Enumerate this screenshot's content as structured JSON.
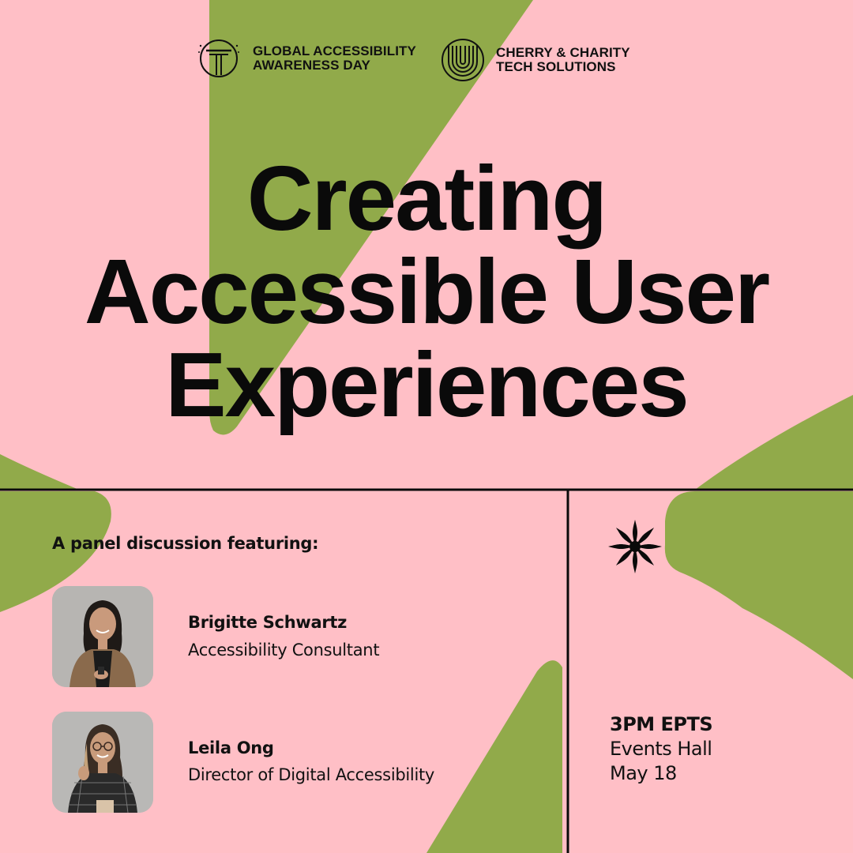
{
  "logos": [
    {
      "icon": "column-pillar-icon",
      "line1": "GLOBAL ACCESSIBILITY",
      "line2": "AWARENESS DAY"
    },
    {
      "icon": "concentric-u-icon",
      "line1": "CHERRY & CHARITY",
      "line2": "TECH SOLUTIONS"
    }
  ],
  "title": {
    "line1": "Creating",
    "line2": "Accessible User",
    "line3": "Experiences"
  },
  "intro": "A panel discussion featuring:",
  "speakers": [
    {
      "name": "Brigitte Schwartz",
      "role": "Accessibility Consultant"
    },
    {
      "name": "Leila Ong",
      "role": "Director of Digital Accessibility"
    }
  ],
  "event": {
    "time": "3PM EPTS",
    "location": "Events Hall",
    "date": "May 18"
  },
  "decor": {
    "icon": "eight-point-star-icon"
  },
  "colors": {
    "background_pink": "#ffbfc6",
    "accent_green": "#91aa4a",
    "ink": "#0a0a0a"
  }
}
